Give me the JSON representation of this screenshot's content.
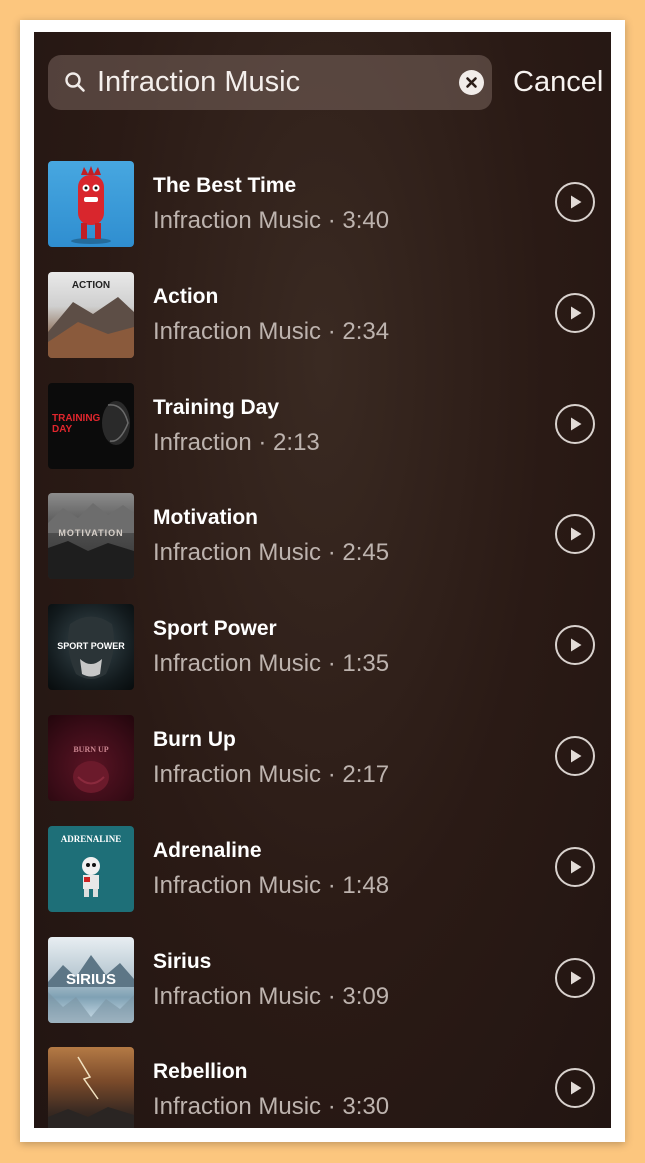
{
  "search": {
    "value": "Infraction Music",
    "cancel_label": "Cancel"
  },
  "tracks": [
    {
      "title": "The Best Time",
      "subtitle": "Infraction Music · 3:40",
      "cover_text": ""
    },
    {
      "title": "Action",
      "subtitle": "Infraction Music · 2:34",
      "cover_text": "ACTION"
    },
    {
      "title": "Training Day",
      "subtitle": "Infraction · 2:13",
      "cover_text": "TRAINING DAY"
    },
    {
      "title": "Motivation",
      "subtitle": "Infraction Music · 2:45",
      "cover_text": "MOTIVATION"
    },
    {
      "title": "Sport Power",
      "subtitle": "Infraction Music · 1:35",
      "cover_text": "SPORT POWER"
    },
    {
      "title": "Burn Up",
      "subtitle": "Infraction Music · 2:17",
      "cover_text": "BURN UP"
    },
    {
      "title": "Adrenaline",
      "subtitle": "Infraction Music · 1:48",
      "cover_text": "ADRENALINE"
    },
    {
      "title": "Sirius",
      "subtitle": "Infraction Music · 3:09",
      "cover_text": "SIRIUS"
    },
    {
      "title": "Rebellion",
      "subtitle": "Infraction Music · 3:30",
      "cover_text": ""
    }
  ],
  "icons": {
    "search": "search-icon",
    "clear": "clear-icon",
    "play": "play-icon"
  }
}
